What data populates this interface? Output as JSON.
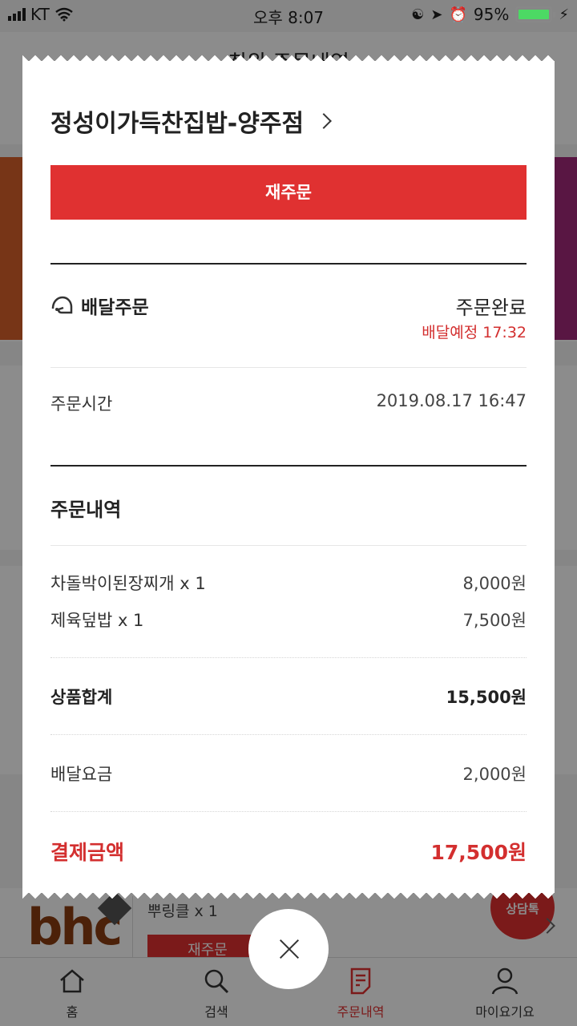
{
  "status_bar": {
    "carrier": "KT",
    "time": "오후 8:07",
    "battery": "95%"
  },
  "background": {
    "header_title": "최위 주문내역",
    "bhc_logo": "bhc",
    "bhc_item": "뿌링클 x 1",
    "bhc_reorder": "재주문",
    "chat_label": "상담톡"
  },
  "receipt": {
    "store_name": "정성이가득찬집밥-양주점",
    "reorder_label": "재주문",
    "delivery_type": "배달주문",
    "order_status": "주문완료",
    "eta": "배달예정 17:32",
    "order_time_label": "주문시간",
    "order_time": "2019.08.17 16:47",
    "order_details_title": "주문내역",
    "items": [
      {
        "name": "차돌박이된장찌개 x 1",
        "price": "8,000원"
      },
      {
        "name": "제육덮밥 x 1",
        "price": "7,500원"
      }
    ],
    "subtotal_label": "상품합계",
    "subtotal": "15,500원",
    "delivery_fee_label": "배달요금",
    "delivery_fee": "2,000원",
    "total_label": "결제금액",
    "total": "17,500원"
  },
  "tabs": [
    {
      "label": "홈",
      "icon": "home-icon"
    },
    {
      "label": "검색",
      "icon": "search-icon"
    },
    {
      "label": "주문내역",
      "icon": "order-list-icon",
      "active": true
    },
    {
      "label": "마이요기요",
      "icon": "profile-icon"
    }
  ],
  "colors": {
    "accent": "#e03131",
    "status_red": "#d32f2f"
  }
}
